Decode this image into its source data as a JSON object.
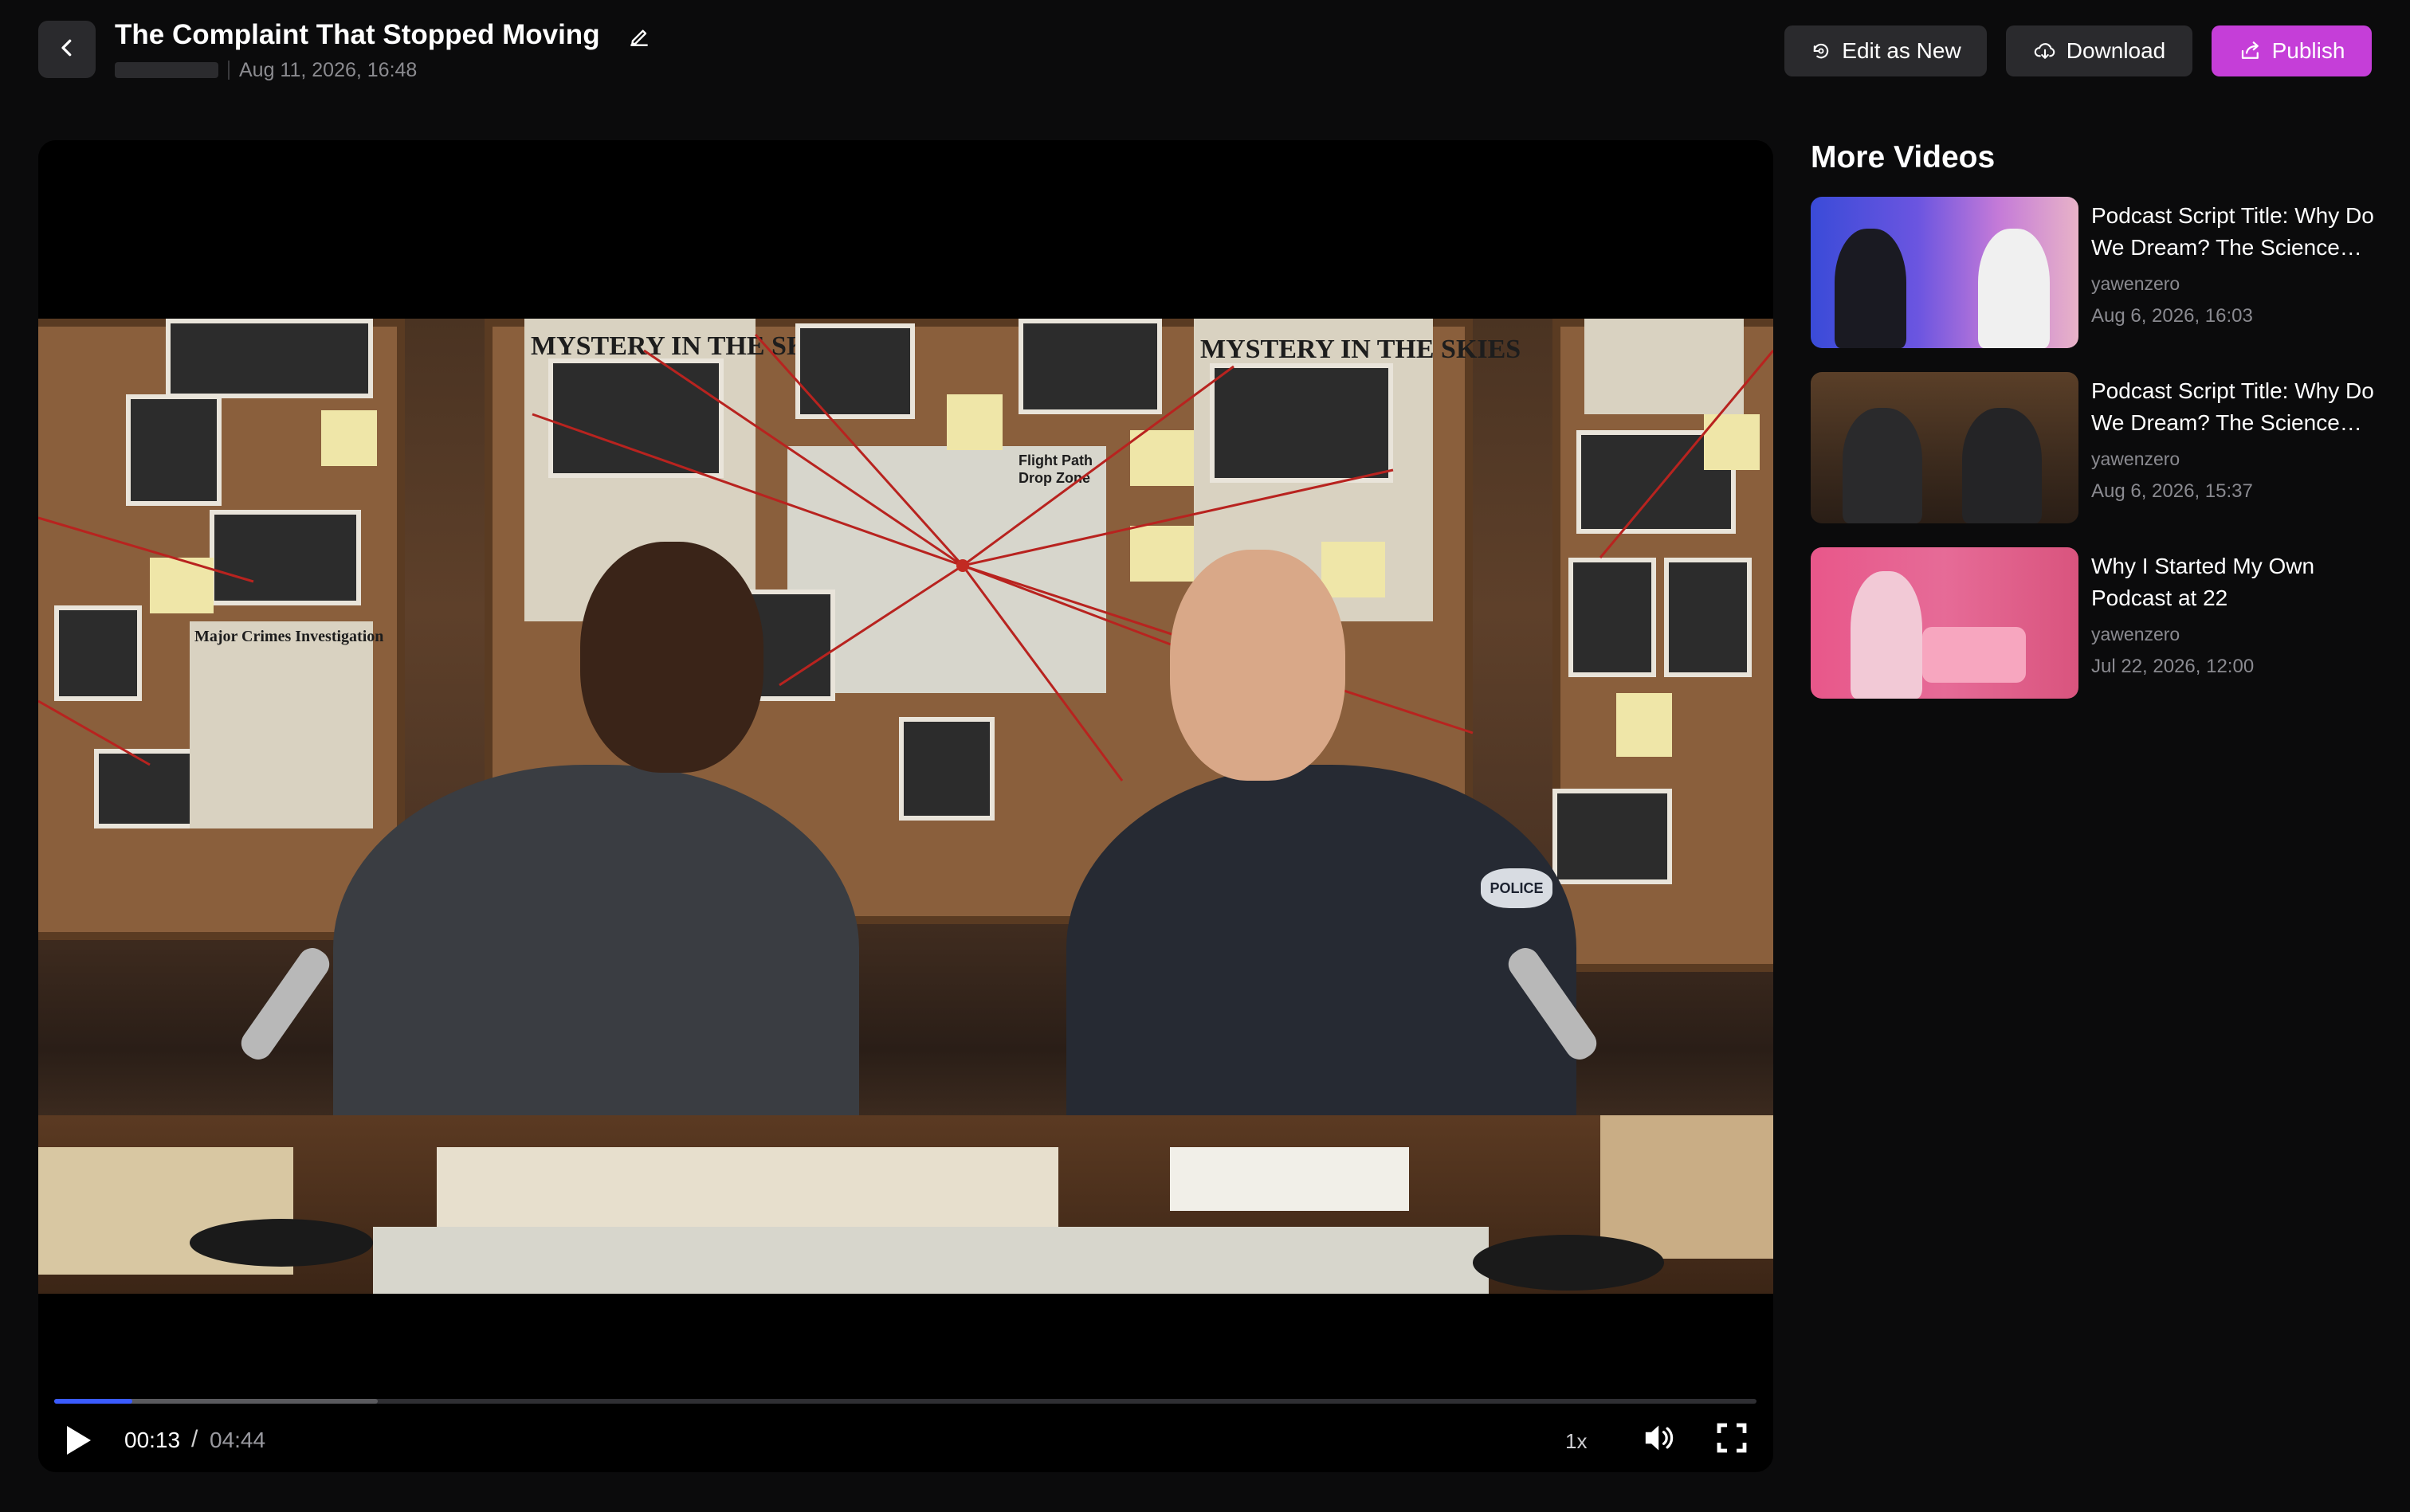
{
  "header": {
    "title": "The Complaint That Stopped Moving",
    "date": "Aug 11, 2026, 16:48",
    "buttons": {
      "edit_as_new": "Edit as New",
      "download": "Download",
      "publish": "Publish"
    },
    "icons": {
      "back": "chevron-left-icon",
      "edit_title": "pencil-icon",
      "edit_as_new": "refresh-icon",
      "download": "cloud-download-icon",
      "publish": "share-icon"
    }
  },
  "player": {
    "scene_text": {
      "headline_left": "MYSTERY IN THE SKIES",
      "headline_right": "MYSTERY IN THE SKIES",
      "board_label": "Major Crimes Investigation",
      "map_label_line1": "Flight Path",
      "map_label_line2": "Drop Zone",
      "badge": "POLICE"
    },
    "current_time": "00:13",
    "separator": "/",
    "duration": "04:44",
    "progress_fraction": 0.046,
    "buffered_fraction": 0.19,
    "speed": "1x"
  },
  "sidebar": {
    "heading": "More Videos",
    "videos": [
      {
        "title": "Podcast Script Title: Why Do We Dream? The Science Behind Our Nightly Adventures",
        "author": "yawenzero",
        "date": "Aug 6, 2026, 16:03"
      },
      {
        "title": "Podcast Script Title: Why Do We Dream? The Science Behind Our Nightly Adventures",
        "author": "yawenzero",
        "date": "Aug 6, 2026, 15:37"
      },
      {
        "title": "Why I Started My Own Podcast at 22",
        "author": "yawenzero",
        "date": "Jul 22, 2026, 12:00"
      }
    ]
  },
  "colors": {
    "background": "#0b0b0c",
    "button_dark": "#2a2a2d",
    "publish": "#c53ed8",
    "progress": "#3a5bff",
    "muted_text": "#8b8b90"
  }
}
